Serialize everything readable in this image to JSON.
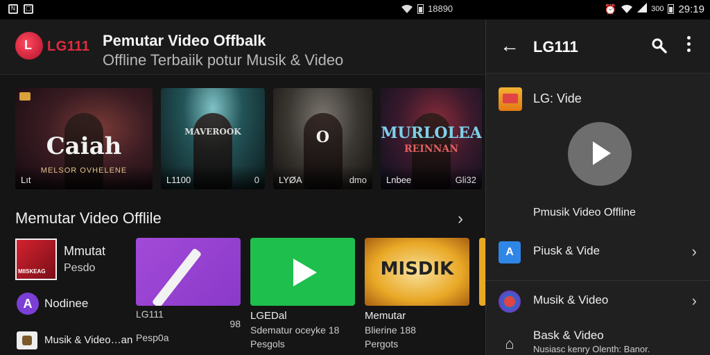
{
  "statusbar": {
    "left_icons": [
      "notification-icon",
      "gallery-icon"
    ],
    "mid_text": "18890",
    "right_time": "29:19",
    "right_pct": "300"
  },
  "header": {
    "brand": "LG111",
    "title": "Pemutar Video Offbalk",
    "subtitle": "Offline Terbaiik potur Musik & Video"
  },
  "featured": [
    {
      "big": "Caiah",
      "sub": "MELSOR OVHELENE",
      "foot_left": "Lıt",
      "foot_right": "",
      "badge": true
    },
    {
      "big": "MAVEROOK",
      "sub": "",
      "foot_left": "L1100",
      "foot_right": "0",
      "badge": false
    },
    {
      "big": "O",
      "sub": "",
      "foot_left": "LYØA",
      "foot_right": "dmo",
      "badge": false
    },
    {
      "big": "MURLOLEA",
      "big2": "REINNAN",
      "sub": "",
      "foot_left": "Lnbee",
      "foot_right": "Gli32",
      "badge": false
    }
  ],
  "section": {
    "title": "Memutar Video Offlile"
  },
  "side_list": [
    {
      "title": "Mmutat",
      "subtitle": "Pesdo"
    },
    {
      "title": "Nodinee",
      "icon_letter": "A"
    },
    {
      "title": "Musik & Video…an"
    }
  ],
  "cards": [
    {
      "title": "LG111",
      "meta": "98",
      "subtitle": "Pesp0a"
    },
    {
      "title": "LGEDal",
      "meta": "Sdematur oceyke 18",
      "subtitle": "Pesgols"
    },
    {
      "title": "Memutar",
      "meta": "Blierine 188",
      "subtitle": "Pergots",
      "image_text": "MISDIK"
    }
  ],
  "drawer": {
    "title": "LG111",
    "app_name": "LG: Vide",
    "caption": "Pmusik Video Offline",
    "items": [
      {
        "label": "Piusk & Vide",
        "icon": "A"
      },
      {
        "label": "Musik & Video"
      },
      {
        "label": "Bask & Video",
        "sub": "Nusiasc kenry Olenth: Banor."
      }
    ]
  },
  "colors": {
    "accent_red": "#e32b3c",
    "green": "#1fbf4e",
    "purple": "#a34ad8",
    "blue": "#2f86e6"
  }
}
